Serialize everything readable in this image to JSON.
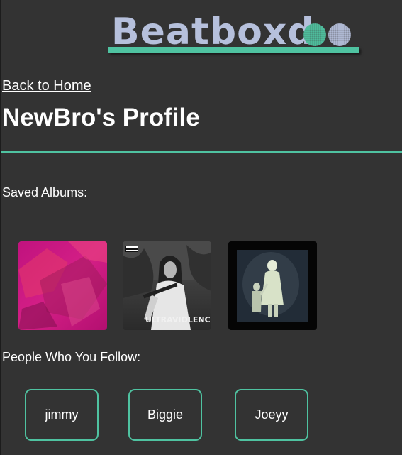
{
  "brand": {
    "name": "Beatboxd",
    "accent_color": "#4fc3a1",
    "logo_text_color": "#b6c0dc"
  },
  "nav": {
    "back_link": "Back to Home"
  },
  "profile": {
    "title": "NewBro's Profile"
  },
  "saved_albums": {
    "label": "Saved Albums:",
    "items": [
      {
        "icon": "album-cover-pink-icon"
      },
      {
        "icon": "album-cover-ultraviolence-icon",
        "cover_text": "ULTRAVIOLENCE",
        "badge": "PARENTAL ADVISORY"
      },
      {
        "icon": "album-cover-dark-night-icon"
      }
    ]
  },
  "following": {
    "label": "People Who You Follow:",
    "users": [
      "jimmy",
      "Biggie",
      "Joeyy"
    ]
  }
}
